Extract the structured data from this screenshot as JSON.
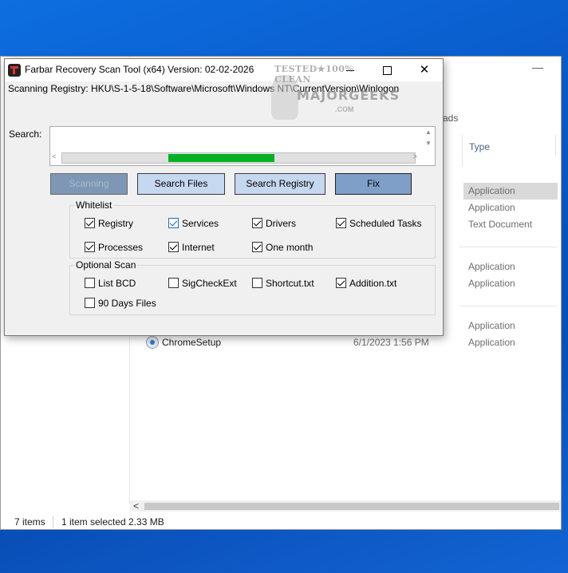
{
  "explorer": {
    "tab_fragment": "ads",
    "type_column_header": "Type",
    "file_types": [
      "Application",
      "Application",
      "Text Document",
      "Application",
      "Application",
      "Application",
      "Application"
    ],
    "visible_file": {
      "name": "ChromeSetup",
      "date": "6/1/2023 1:56 PM"
    },
    "status": {
      "item_count": "7 items",
      "selection": "1 item selected  2.33 MB"
    }
  },
  "frst": {
    "title": "Farbar Recovery Scan Tool (x64) Version: 02-02-2026",
    "scan_status": "Scanning Registry: HKU\\S-1-5-18\\Software\\Microsoft\\Windows NT\\CurrentVersion\\Winlogon",
    "search_label": "Search:",
    "progress_fraction": 0.3,
    "progress_start_fraction": 0.3,
    "buttons": {
      "scanning": "Scanning",
      "search_files": "Search Files",
      "search_registry": "Search Registry",
      "fix": "Fix"
    },
    "whitelist": {
      "title": "Whitelist",
      "items": [
        {
          "label": "Registry",
          "checked": true
        },
        {
          "label": "Services",
          "checked": true
        },
        {
          "label": "Drivers",
          "checked": true
        },
        {
          "label": "Scheduled Tasks",
          "checked": true
        },
        {
          "label": "Processes",
          "checked": true
        },
        {
          "label": "Internet",
          "checked": true
        },
        {
          "label": "One month",
          "checked": true
        }
      ]
    },
    "optional_scan": {
      "title": "Optional Scan",
      "items": [
        {
          "label": "List BCD",
          "checked": false
        },
        {
          "label": "SigCheckExt",
          "checked": false
        },
        {
          "label": "Shortcut.txt",
          "checked": false
        },
        {
          "label": "Addition.txt",
          "checked": true
        },
        {
          "label": "90 Days Files",
          "checked": false
        }
      ]
    }
  },
  "watermark": {
    "top": "TESTED★100% CLEAN",
    "main": "MAJORGEEKS",
    "bottom": ".COM"
  }
}
